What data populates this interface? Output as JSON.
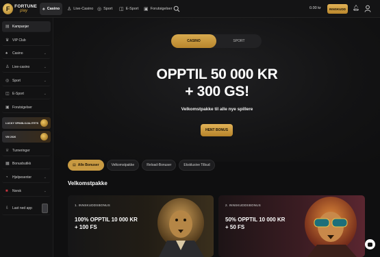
{
  "logo": {
    "line1": "FORTUNE",
    "line2": "play"
  },
  "nav": [
    {
      "label": "Casino",
      "icon": "casino-icon",
      "active": true
    },
    {
      "label": "Live-Casino",
      "icon": "live-casino-icon"
    },
    {
      "label": "Sport",
      "icon": "sport-icon"
    },
    {
      "label": "E-Sport",
      "icon": "esport-icon"
    },
    {
      "label": "Forutsigelser",
      "icon": "predictions-icon"
    }
  ],
  "header": {
    "balance": "0.00 kr",
    "deposit_label": "INNSKUDD"
  },
  "sidebar": {
    "items": [
      {
        "label": "Kampanjer",
        "icon": "gift-icon"
      },
      {
        "label": "VIP Club",
        "icon": "crown-icon"
      },
      {
        "label": "Casino",
        "icon": "casino-icon"
      },
      {
        "label": "Live-casino",
        "icon": "live-casino-icon"
      },
      {
        "label": "Sport",
        "icon": "sport-icon"
      },
      {
        "label": "E-Sport",
        "icon": "esport-icon"
      },
      {
        "label": "Forutsigelser",
        "icon": "predictions-icon"
      },
      {
        "label": "Turneringer",
        "icon": "trophy-icon"
      },
      {
        "label": "Bonusbutikk",
        "icon": "shop-icon"
      },
      {
        "label": "Hjelpesenter",
        "icon": "help-icon"
      },
      {
        "label": "Norsk",
        "icon": "flag-icon"
      },
      {
        "label": "Last ned app",
        "icon": "download-icon"
      }
    ],
    "promo1_a": "LUCKY SPINS",
    "promo1_b": "LOJALITETS",
    "promo2": "VM 2026"
  },
  "hero": {
    "switch_casino": "CASINO",
    "switch_sport": "SPORT",
    "title_line1": "OPPTIL 50 000 KR",
    "title_line2": "+ 300 GS!",
    "subtitle": "Velkomstpakke til alle nye spillere",
    "cta": "HENT BONUS"
  },
  "filters": [
    "Alle Bonuser",
    "Velkomstpakke",
    "Reload-Bonuser",
    "Eksklusive Tilbud"
  ],
  "section_title": "Velkomstpakke",
  "cards": [
    {
      "tag": "1. INNSKUDDSBONUS",
      "title1": "100% OPPTIL 10 000 KR",
      "title2": "+ 100 FS"
    },
    {
      "tag": "2. INNSKUDDSBONUS",
      "title1": "50% OPPTIL 10 000 KR",
      "title2": "+ 50 FS"
    }
  ],
  "colors": {
    "accent_gold": "#d4a53f",
    "background": "#0f0f10"
  }
}
